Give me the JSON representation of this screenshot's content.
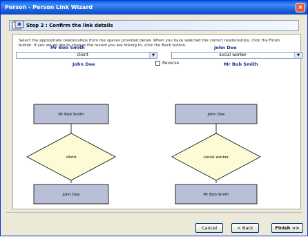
{
  "window": {
    "title": "Person - Person Link Wizard",
    "close_glyph": "×"
  },
  "step": {
    "title": "Step 2 : Confirm the link details"
  },
  "instructions": "Select the appropriate relationships from the spaces provided below. When you have selected the correct relationships, click the Finish button. If you would like to change the record you are linking to, click the Back button.",
  "left": {
    "person_top": "Mr Bob Smith",
    "relationship": "client",
    "person_bottom": "John Doe"
  },
  "right": {
    "person_top": "John Doe",
    "relationship": "social worker",
    "person_bottom": "Mr Bob Smith"
  },
  "reverse": {
    "label": "Reverse",
    "checked": false
  },
  "diagram": {
    "left": {
      "top_box": "Mr Bob Smith",
      "diamond": "client",
      "bottom_box": "John Doe"
    },
    "right": {
      "top_box": "John Doe",
      "diamond": "social worker",
      "bottom_box": "Mr Bob Smith"
    }
  },
  "buttons": {
    "cancel": "Cancel",
    "back": "< Back",
    "finish": "Finish >>"
  },
  "colors": {
    "box_fill": "#b9bfd6",
    "diamond_fill": "#fcfbd6",
    "name_color": "#1a2d8c"
  },
  "icons": {
    "step": "wizard-step-icon",
    "dropdown": "chevron-down-icon",
    "close": "close-icon"
  }
}
